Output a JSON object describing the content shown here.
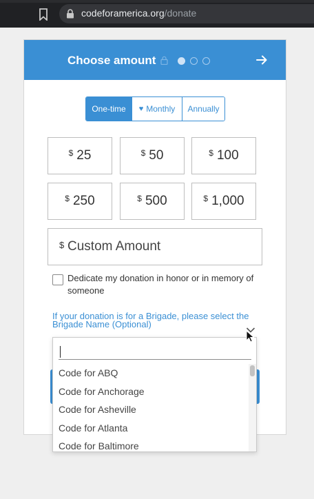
{
  "browser": {
    "domain": "codeforamerica.org",
    "path": "/donate"
  },
  "header": {
    "title": "Choose amount",
    "steps_total": 3,
    "current_step": 1
  },
  "frequency": {
    "options": [
      "One-time",
      "Monthly",
      "Annually"
    ],
    "selected": "One-time"
  },
  "amounts": {
    "currency_symbol": "$",
    "values": [
      "25",
      "50",
      "100",
      "250",
      "500",
      "1,000"
    ]
  },
  "custom_amount": {
    "currency_symbol": "$",
    "placeholder": "Custom Amount"
  },
  "dedication": {
    "checked": false,
    "label": "Dedicate my donation in honor or in memory of someone"
  },
  "brigade": {
    "label": "If your donation is for a Brigade, please select the Brigade Name (Optional)",
    "search_value": "",
    "options": [
      "Code for ABQ",
      "Code for Anchorage",
      "Code for Asheville",
      "Code for Atlanta",
      "Code for Baltimore"
    ]
  },
  "colors": {
    "accent": "#3a8fd4",
    "browser_bg": "#202124"
  },
  "icons": {
    "bookmark": "bookmark-icon",
    "lock": "lock-icon",
    "step_lock": "lock-icon",
    "next": "arrow-right-icon",
    "heart": "heart-icon",
    "dropdown": "chevron-down-icon",
    "cursor": "mouse-pointer-icon"
  }
}
